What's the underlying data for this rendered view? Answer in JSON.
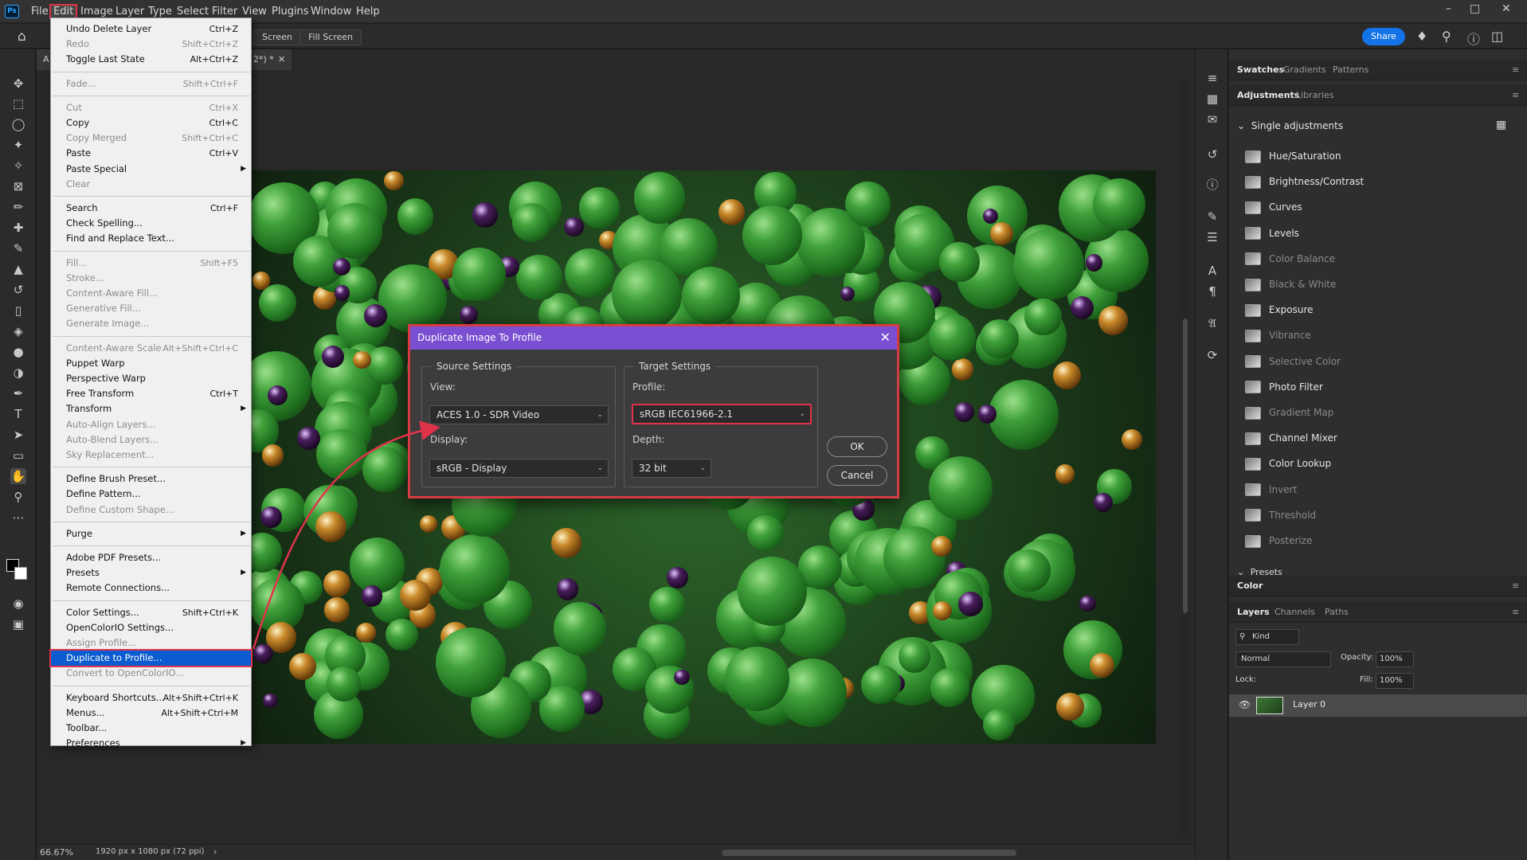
{
  "app": {
    "logo": "Ps"
  },
  "menubar": {
    "items": [
      "File",
      "Edit",
      "Image",
      "Layer",
      "Type",
      "Select",
      "Filter",
      "View",
      "Plugins",
      "Window",
      "Help"
    ],
    "active": "Edit"
  },
  "optionsbar": {
    "screen_label": "Screen",
    "fill_screen_label": "Fill Screen",
    "share_label": "Share"
  },
  "document": {
    "tab_title": "2*) *",
    "tab_prefix": "A"
  },
  "edit_menu": {
    "items": [
      {
        "label": "Undo Delete Layer",
        "shortcut": "Ctrl+Z",
        "enabled": true
      },
      {
        "label": "Redo",
        "shortcut": "Shift+Ctrl+Z",
        "enabled": false
      },
      {
        "label": "Toggle Last State",
        "shortcut": "Alt+Ctrl+Z",
        "enabled": true
      },
      {
        "sep": true
      },
      {
        "label": "Fade...",
        "shortcut": "Shift+Ctrl+F",
        "enabled": false
      },
      {
        "sep": true
      },
      {
        "label": "Cut",
        "shortcut": "Ctrl+X",
        "enabled": false
      },
      {
        "label": "Copy",
        "shortcut": "Ctrl+C",
        "enabled": true
      },
      {
        "label": "Copy Merged",
        "shortcut": "Shift+Ctrl+C",
        "enabled": false
      },
      {
        "label": "Paste",
        "shortcut": "Ctrl+V",
        "enabled": true
      },
      {
        "label": "Paste Special",
        "shortcut": "",
        "enabled": true,
        "submenu": true
      },
      {
        "label": "Clear",
        "shortcut": "",
        "enabled": false
      },
      {
        "sep": true
      },
      {
        "label": "Search",
        "shortcut": "Ctrl+F",
        "enabled": true
      },
      {
        "label": "Check Spelling...",
        "shortcut": "",
        "enabled": true
      },
      {
        "label": "Find and Replace Text...",
        "shortcut": "",
        "enabled": true
      },
      {
        "sep": true
      },
      {
        "label": "Fill...",
        "shortcut": "Shift+F5",
        "enabled": false
      },
      {
        "label": "Stroke...",
        "shortcut": "",
        "enabled": false
      },
      {
        "label": "Content-Aware Fill...",
        "shortcut": "",
        "enabled": false
      },
      {
        "label": "Generative Fill...",
        "shortcut": "",
        "enabled": false
      },
      {
        "label": "Generate Image...",
        "shortcut": "",
        "enabled": false
      },
      {
        "sep": true
      },
      {
        "label": "Content-Aware Scale",
        "shortcut": "Alt+Shift+Ctrl+C",
        "enabled": false
      },
      {
        "label": "Puppet Warp",
        "shortcut": "",
        "enabled": true
      },
      {
        "label": "Perspective Warp",
        "shortcut": "",
        "enabled": true
      },
      {
        "label": "Free Transform",
        "shortcut": "Ctrl+T",
        "enabled": true
      },
      {
        "label": "Transform",
        "shortcut": "",
        "enabled": true,
        "submenu": true
      },
      {
        "label": "Auto-Align Layers...",
        "shortcut": "",
        "enabled": false
      },
      {
        "label": "Auto-Blend Layers...",
        "shortcut": "",
        "enabled": false
      },
      {
        "label": "Sky Replacement...",
        "shortcut": "",
        "enabled": false
      },
      {
        "sep": true
      },
      {
        "label": "Define Brush Preset...",
        "shortcut": "",
        "enabled": true
      },
      {
        "label": "Define Pattern...",
        "shortcut": "",
        "enabled": true
      },
      {
        "label": "Define Custom Shape...",
        "shortcut": "",
        "enabled": false
      },
      {
        "sep": true
      },
      {
        "label": "Purge",
        "shortcut": "",
        "enabled": true,
        "submenu": true
      },
      {
        "sep": true
      },
      {
        "label": "Adobe PDF Presets...",
        "shortcut": "",
        "enabled": true
      },
      {
        "label": "Presets",
        "shortcut": "",
        "enabled": true,
        "submenu": true
      },
      {
        "label": "Remote Connections...",
        "shortcut": "",
        "enabled": true
      },
      {
        "sep": true
      },
      {
        "label": "Color Settings...",
        "shortcut": "Shift+Ctrl+K",
        "enabled": true
      },
      {
        "label": "OpenColorIO Settings...",
        "shortcut": "",
        "enabled": true
      },
      {
        "label": "Assign Profile...",
        "shortcut": "",
        "enabled": false
      },
      {
        "label": "Duplicate to Profile...",
        "shortcut": "",
        "enabled": true,
        "highlighted": true
      },
      {
        "label": "Convert to OpenColorIO...",
        "shortcut": "",
        "enabled": false
      },
      {
        "sep": true
      },
      {
        "label": "Keyboard Shortcuts...",
        "shortcut": "Alt+Shift+Ctrl+K",
        "enabled": true
      },
      {
        "label": "Menus...",
        "shortcut": "Alt+Shift+Ctrl+M",
        "enabled": true
      },
      {
        "label": "Toolbar...",
        "shortcut": "",
        "enabled": true
      },
      {
        "label": "Preferences",
        "shortcut": "",
        "enabled": true,
        "submenu": true
      }
    ]
  },
  "dialog": {
    "title": "Duplicate Image To Profile",
    "source": {
      "legend": "Source Settings",
      "view_label": "View:",
      "view_value": "ACES 1.0 - SDR Video",
      "display_label": "Display:",
      "display_value": "sRGB - Display"
    },
    "target": {
      "legend": "Target Settings",
      "profile_label": "Profile:",
      "profile_value": "sRGB IEC61966-2.1",
      "depth_label": "Depth:",
      "depth_value": "32 bit"
    },
    "ok_label": "OK",
    "cancel_label": "Cancel"
  },
  "right_panel": {
    "top_tabs": [
      "Swatches",
      "Gradients",
      "Patterns"
    ],
    "adj_tabs": [
      "Adjustments",
      "Libraries"
    ],
    "single_adjustments_label": "Single adjustments",
    "adjustments": [
      {
        "label": "Hue/Saturation",
        "enabled": true
      },
      {
        "label": "Brightness/Contrast",
        "enabled": true
      },
      {
        "label": "Curves",
        "enabled": true
      },
      {
        "label": "Levels",
        "enabled": true
      },
      {
        "label": "Color Balance",
        "enabled": false
      },
      {
        "label": "Black & White",
        "enabled": false
      },
      {
        "label": "Exposure",
        "enabled": true
      },
      {
        "label": "Vibrance",
        "enabled": false
      },
      {
        "label": "Selective Color",
        "enabled": false
      },
      {
        "label": "Photo Filter",
        "enabled": true
      },
      {
        "label": "Gradient Map",
        "enabled": false
      },
      {
        "label": "Channel Mixer",
        "enabled": true
      },
      {
        "label": "Color Lookup",
        "enabled": true
      },
      {
        "label": "Invert",
        "enabled": false
      },
      {
        "label": "Threshold",
        "enabled": false
      },
      {
        "label": "Posterize",
        "enabled": false
      }
    ],
    "presets_label": "Presets",
    "color_tab": "Color",
    "layer_tabs": [
      "Layers",
      "Channels",
      "Paths"
    ],
    "kind_label": "Kind",
    "blend_mode": "Normal",
    "opacity_label": "Opacity:",
    "opacity_value": "100%",
    "lock_label": "Lock:",
    "fill_label": "Fill:",
    "fill_value": "100%",
    "layer_name": "Layer 0"
  },
  "status": {
    "zoom": "66.67%",
    "info": "1920 px x 1080 px (72 ppi)"
  },
  "colors": {
    "accent": "#1473e6",
    "dialog_title": "#7a4fd1",
    "annotation_red": "#e0334a",
    "menu_highlight": "#0b5cd0"
  }
}
